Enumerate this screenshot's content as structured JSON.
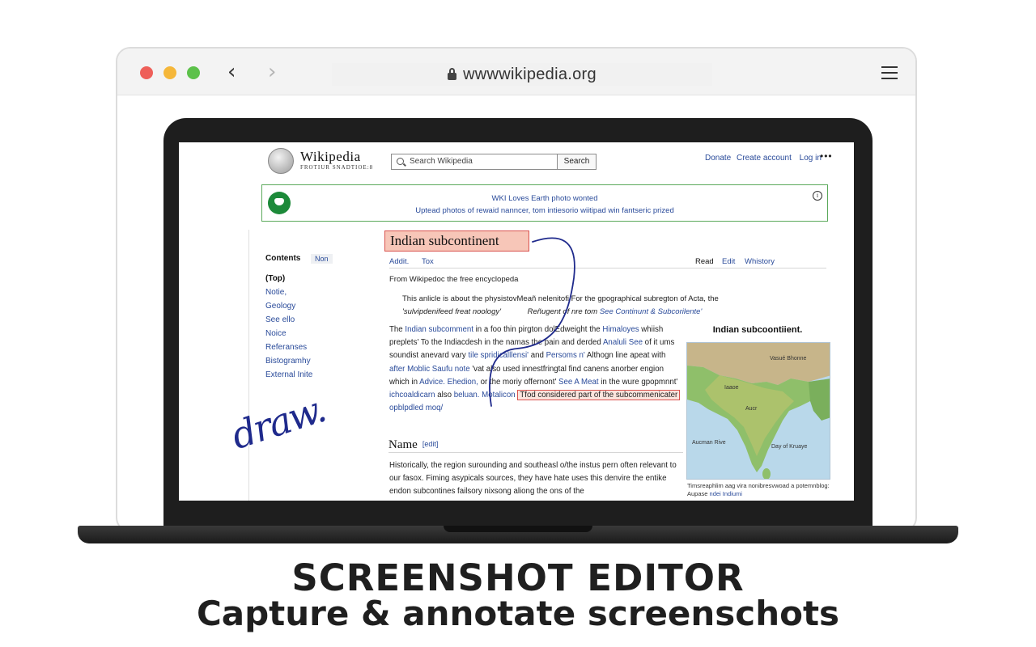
{
  "browser": {
    "url": "wwwwikipedia.org",
    "back_icon": "chevron-left-icon",
    "forward_icon": "chevron-right-icon",
    "lock_icon": "lock-icon",
    "menu_icon": "hamburger-menu-icon"
  },
  "wiki": {
    "logo_name": "Wikipedia",
    "tagline": "FROTIUR SNADTIOE:8",
    "search_placeholder": "Search Wikipedia",
    "search_button": "Search",
    "donate": "Donate",
    "create_account": "Create account",
    "login": "Log in",
    "more": "•••",
    "banner_line1": "WKI Loves Earth photo wonted",
    "banner_line2": "Uptead photos of rewaid nanncer, tom intiesorio wiitipad win fantseric prized",
    "banner_info": "i",
    "contents_title": "Contents",
    "contents_hide": "Non",
    "toc": [
      "(Top)",
      "Notie,",
      "Geology",
      "See ello",
      "Noice",
      "Referanses",
      "Bistogramhy",
      "External Inite"
    ],
    "article_title": "Indian subcontinent",
    "tab_article": "Addit.",
    "tab_talk": "Tox",
    "tab_read": "Read",
    "tab_edit": "Edit",
    "tab_history": "Whistory",
    "from_wiki": "From Wikipedoc the free encyclopeda",
    "hatnote_1a": "This anlicle is about the physistovMeañ nelenitofi For the gpographical subregton of Acta, the",
    "hatnote_2a": "'sulvipdenifeed freat noology'",
    "hatnote_2b": "Reñugent of nre tom",
    "hatnote_2c": "See Continunt & Subcorilente'",
    "p1_t1": "The ",
    "p1_l1": "Indian subcomment",
    "p1_t2": " in a foo thin pirgton dolEdweight the ",
    "p1_l2": "Himaloyes",
    "p1_t3": " whiish preplets' To the Indiacdesh in the namas the pain and derded ",
    "p1_l3": "Analuli See",
    "p1_t4": " of it ums soundist anevard vary ",
    "p1_l4": "tile spridicalllensi'",
    "p1_t5": " and ",
    "p1_l5": "Persoms n'",
    "p1_t6": " Althogn line apeat with ",
    "p1_l6": "after Moblic Saufu note",
    "p1_t7": " 'vat also used innestfringtal find canens anorber engion which in ",
    "p1_l7": "Advice. Ehedion,",
    "p1_t8": " or the moriy offernont'  ",
    "p1_l8": "See A Meat",
    "p1_t9": " in the wure gpopmnnt' ",
    "p1_l9": "ichcoaldicarn",
    "p1_t10": " also ",
    "p1_l10": "beluan. Motalicon",
    "p1_hl": "Tfod considered part of the subcommenicater",
    "p1_l11": "opblpdled moq/",
    "section_name": "Name",
    "section_edit": "[edit]",
    "p2": "Historically, the region surounding and southeasl o/the instus pern often relevant to our fasox. Fiming asypicals sources, they have hate uses this denvire the entike endon subcontines failsory nixsong aliong the ons of the",
    "infobox_title": "Indian subcoontiient.",
    "map_label_1": "Vasué Bhonne",
    "map_label_2": "Iaaoe",
    "map_label_3": "Aucr",
    "map_label_4": "Aucman Rive",
    "map_label_5": "Day of Kruaye",
    "caption": "Timsreaphlim aag vira nonibresvwoad a potemnblog: Aupase ",
    "caption_link": "ndei Indiumi"
  },
  "annotation": {
    "handwritten": "draw.",
    "pen_color": "#1f2a8c",
    "highlight_color": "#d9534f"
  },
  "promo": {
    "headline": "SCREENSHOT EDITOR",
    "subline": "Capture & annotate screenschots"
  }
}
